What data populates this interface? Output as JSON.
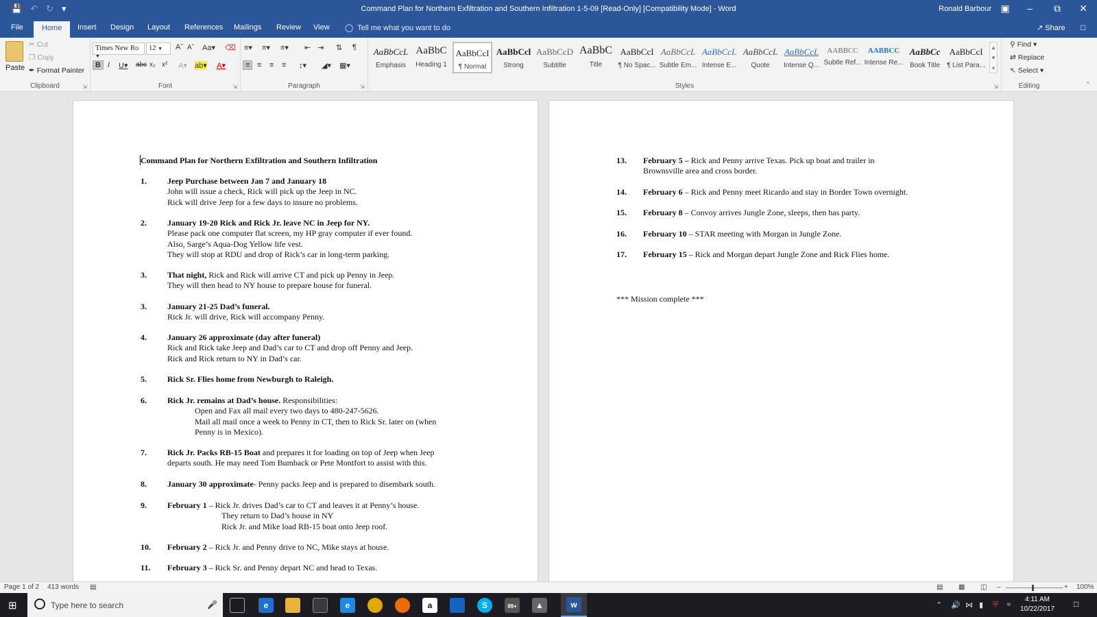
{
  "app": {
    "window_title": "Command Plan for Northern Exfiltration and Southern Infiltration  1-5-09 [Read-Only] [Compatibility Mode]  -  Word",
    "user": "Ronald Barbour"
  },
  "tabs": [
    "File",
    "Home",
    "Insert",
    "Design",
    "Layout",
    "References",
    "Mailings",
    "Review",
    "View"
  ],
  "tell_me_placeholder": "Tell me what you want to do",
  "share_label": "Share",
  "ribbon": {
    "clipboard": {
      "paste": "Paste",
      "cut": "Cut",
      "copy": "Copy",
      "format_painter": "Format Painter",
      "label": "Clipboard"
    },
    "font": {
      "name": "Times New Ro",
      "size": "12",
      "label": "Font"
    },
    "paragraph": {
      "label": "Paragraph"
    },
    "styles": {
      "label": "Styles",
      "items": [
        {
          "sample": "AaBbCcL",
          "name": "Emphasis"
        },
        {
          "sample": "AaBbC",
          "name": "Heading 1"
        },
        {
          "sample": "AaBbCcI",
          "name": "¶ Normal"
        },
        {
          "sample": "AaBbCcl",
          "name": "Strong"
        },
        {
          "sample": "AaBbCcD",
          "name": "Subtitle"
        },
        {
          "sample": "AaBbC",
          "name": "Title"
        },
        {
          "sample": "AaBbCcI",
          "name": "¶ No Spac..."
        },
        {
          "sample": "AaBbCcL",
          "name": "Subtle Em..."
        },
        {
          "sample": "AaBbCcL",
          "name": "Intense E..."
        },
        {
          "sample": "AaBbCcL",
          "name": "Quote"
        },
        {
          "sample": "AaBbCcL",
          "name": "Intense Q..."
        },
        {
          "sample": "AABBCC",
          "name": "Subtle Ref..."
        },
        {
          "sample": "AABBCC",
          "name": "Intense Re..."
        },
        {
          "sample": "AaBbCc",
          "name": "Book Title"
        },
        {
          "sample": "AaBbCcI",
          "name": "¶ List Para..."
        }
      ],
      "selected": "¶ Normal"
    },
    "editing": {
      "find": "Find",
      "replace": "Replace",
      "select": "Select",
      "label": "Editing"
    }
  },
  "document": {
    "title": "Command Plan for Northern Exfiltration and Southern Infiltration",
    "page1": [
      {
        "num": "1.",
        "heading": "Jeep Purchase between Jan 7 and January 18",
        "rest": "",
        "lines": [
          "John will issue a check, Rick will pick up the Jeep in NC.",
          "Rick will drive Jeep for a few days to insure no problems."
        ]
      },
      {
        "num": "2.",
        "heading": "January 19-20 Rick and Rick Jr. leave NC in Jeep for NY.",
        "rest": "",
        "lines": [
          "Please pack one computer flat screen, my HP gray computer if ever found.",
          "Also, Sarge’s Aqua-Dog Yellow life vest.",
          "They will stop at RDU and drop of Rick’s car in long-term parking."
        ]
      },
      {
        "num": "3.",
        "heading": "That night,",
        "rest": " Rick and Rick will arrive CT and pick up Penny in Jeep.",
        "lines": [
          "They will then head to NY house to prepare house for funeral."
        ]
      },
      {
        "num": "3.",
        "heading": "January 21-25 Dad’s funeral.",
        "rest": "",
        "lines": [
          "Rick Jr. will drive, Rick will accompany Penny."
        ]
      },
      {
        "num": "4.",
        "heading": "January 26 approximate (day after funeral)",
        "rest": "",
        "lines": [
          "Rick and Rick take Jeep and Dad’s car to CT and drop off Penny and Jeep.",
          "Rick and Rick return to NY in Dad’s car."
        ]
      },
      {
        "num": "5.",
        "heading": "Rick Sr. Flies home from Newburgh to Raleigh.",
        "rest": "",
        "lines": []
      },
      {
        "num": "6.",
        "heading": "Rick Jr. remains at Dad’s house.",
        "rest": "  Responsibilities:",
        "lines": [
          "Open and Fax all mail every two days to 480-247-5626.",
          "Mail all mail once a week to Penny in CT, then to Rick Sr. later on (when",
          "Penny is in Mexico)."
        ]
      },
      {
        "num": "7.",
        "heading": "Rick Jr. Packs RB-15 Boat",
        "rest": " and prepares it for loading on top of Jeep when Jeep",
        "lines": [
          "departs south.  He may need Tom Bumback or Pete Montfort to assist with this."
        ]
      },
      {
        "num": "8.",
        "heading": "January 30 approximate",
        "rest": "- Penny packs Jeep and is prepared to disembark south.",
        "lines": []
      },
      {
        "num": "9.",
        "heading": "February 1",
        "rest": " –  Rick Jr. drives Dad’s car to CT and leaves it at Penny’s house.",
        "lines": [
          "They return to Dad’s house in NY",
          "Rick Jr. and Mike load RB-15 boat onto Jeep roof."
        ]
      },
      {
        "num": "10.",
        "heading": "February 2",
        "rest": " –  Rick Jr. and Penny drive to NC, Mike stays at house.",
        "lines": []
      },
      {
        "num": "11.",
        "heading": "February 3",
        "rest": " –  Rick Sr. and Penny depart NC and head to Texas.",
        "lines": []
      }
    ],
    "page2": [
      {
        "num": "13.",
        "heading": "February 5 –",
        "rest": " Rick and Penny arrive Texas.  Pick up boat and trailer in",
        "lines": [
          "Brownsville area and cross border."
        ]
      },
      {
        "num": "14.",
        "heading": "February 6",
        "rest": " – Rick and Penny meet Ricardo and stay in Border Town overnight.",
        "lines": []
      },
      {
        "num": "15.",
        "heading": "February 8",
        "rest": " – Convoy arrives Jungle Zone, sleeps, then has party.",
        "lines": []
      },
      {
        "num": "16.",
        "heading": "February 10",
        "rest": " – STAR meeting with Morgan in Jungle Zone.",
        "lines": []
      },
      {
        "num": "17.",
        "heading": "February 15",
        "rest": " – Rick and Morgan depart Jungle Zone and Rick Flies home.",
        "lines": []
      }
    ],
    "closing": "*** Mission complete ***"
  },
  "status": {
    "page": "Page 1 of 2",
    "words": "413 words",
    "zoom": "100%"
  },
  "taskbar": {
    "search_placeholder": "Type here to search",
    "time": "4:11 AM",
    "date": "10/22/2017",
    "mail_badge": "99+"
  }
}
